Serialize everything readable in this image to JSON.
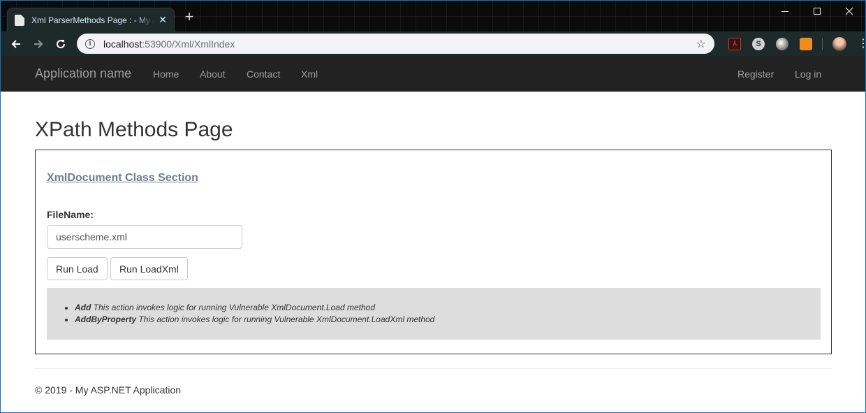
{
  "browser": {
    "tab_title": "Xml ParserMethods Page : - My ASP.NET Application",
    "tab_close": "✕",
    "new_tab": "+",
    "url_host": "localhost",
    "url_rest": ":53900/Xml/XmlIndex",
    "star": "☆",
    "skype_label": "S",
    "pdf_label": "⅄"
  },
  "navbar": {
    "brand": "Application name",
    "links": [
      "Home",
      "About",
      "Contact",
      "Xml"
    ],
    "register": "Register",
    "login": "Log in"
  },
  "page": {
    "title": "XPath Methods Page",
    "section_link": "XmlDocument Class Section",
    "filename_label": "FileName:",
    "filename_value": "userscheme.xml",
    "btn_load": "Run Load",
    "btn_loadxml": "Run LoadXml",
    "info": [
      {
        "term": "Add",
        "desc": " This action invokes logic for running Vulnerable XmlDocument.Load method"
      },
      {
        "term": "AddByProperty",
        "desc": " This action invokes logic for running Vulnerable XmlDocument.LoadXml method"
      }
    ]
  },
  "footer": {
    "text": "© 2019 - My ASP.NET Application"
  }
}
